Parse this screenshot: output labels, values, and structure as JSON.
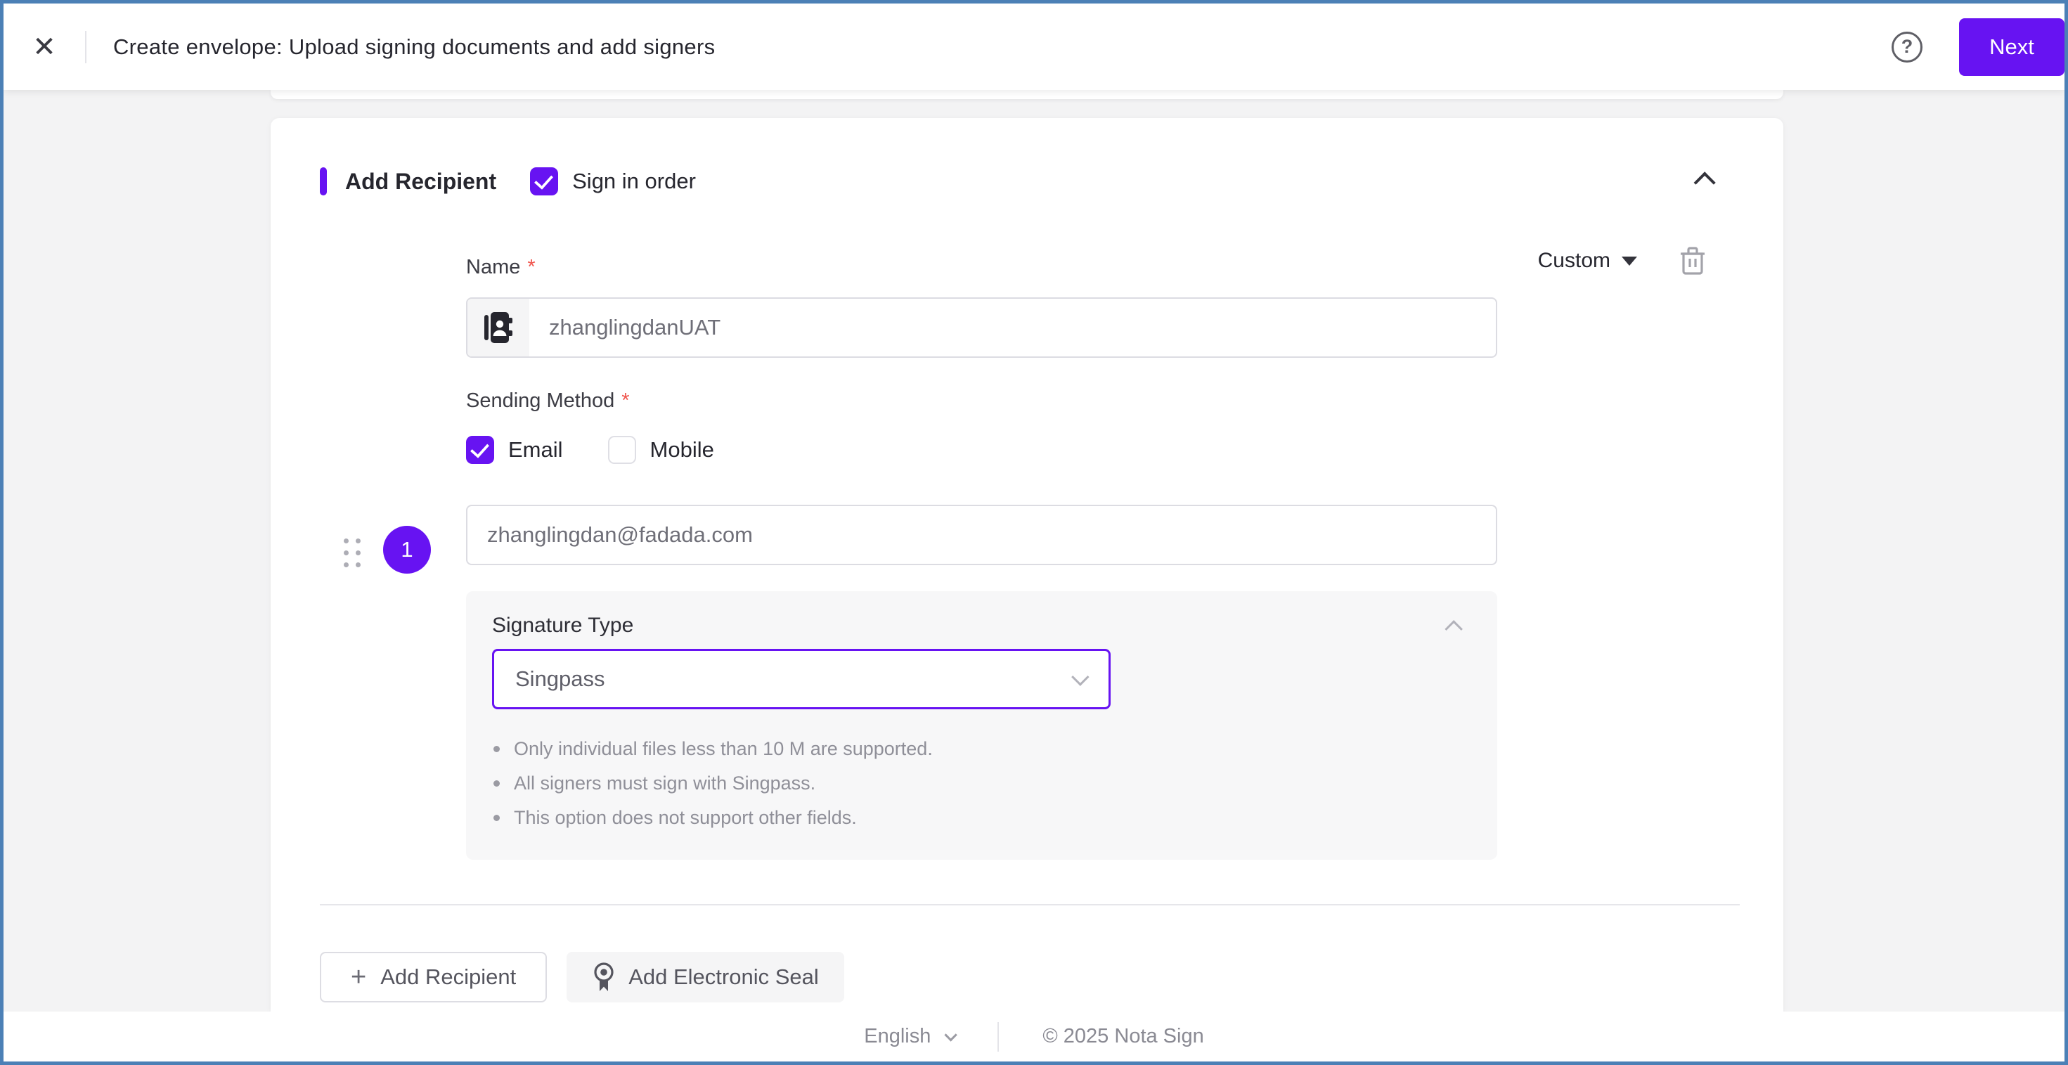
{
  "colors": {
    "accent": "#6713F2",
    "frame_border": "#4C80B6"
  },
  "icons": {
    "close": "✕",
    "help": "?",
    "plus": "+"
  },
  "header": {
    "title": "Create envelope: Upload signing documents and add signers",
    "next_label": "Next"
  },
  "card": {
    "section_title": "Add Recipient",
    "required_mark": "*",
    "sign_in_order": {
      "label": "Sign in order",
      "checked": true
    },
    "role_select": {
      "value": "Custom"
    },
    "name_field": {
      "label": "Name",
      "value": "zhanglingdanUAT"
    },
    "sending_method": {
      "label": "Sending Method",
      "options": [
        {
          "label": "Email",
          "checked": true
        },
        {
          "label": "Mobile",
          "checked": false
        }
      ]
    },
    "recipient_number": "1",
    "contact_field": {
      "value": "zhanglingdan@fadada.com"
    },
    "signature_type": {
      "title": "Signature Type",
      "selected": "Singpass",
      "notes": [
        "Only individual files less than 10 M are supported.",
        "All signers must sign with Singpass.",
        "This option does not support other fields."
      ]
    },
    "actions": {
      "add_recipient": "Add Recipient",
      "add_seal": "Add Electronic Seal"
    }
  },
  "footer": {
    "language": "English",
    "copyright": "© 2025 Nota Sign"
  }
}
